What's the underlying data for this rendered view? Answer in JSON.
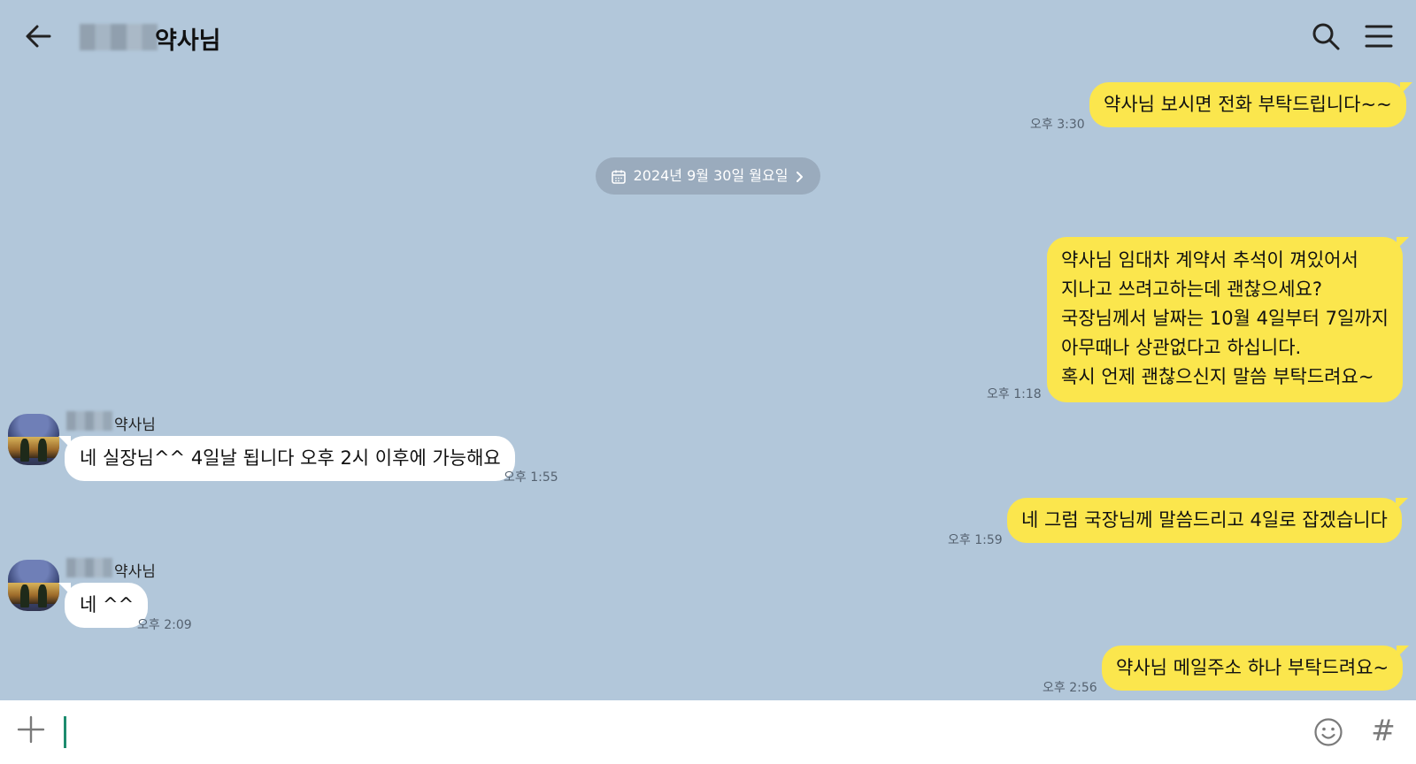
{
  "header": {
    "contact_name": "약사님",
    "icons": {
      "back": "arrow-left-icon",
      "search": "search-icon",
      "menu": "hamburger-menu-icon"
    }
  },
  "date_separator": {
    "label": "2024년 9월 30일 월요일",
    "icon": "calendar-icon",
    "chevron": "chevron-right-icon"
  },
  "messages": [
    {
      "direction": "out",
      "text": "약사님 보시면 전화 부탁드립니다~~",
      "time": "오후 3:30"
    },
    {
      "direction": "out",
      "lines": [
        "약사님 임대차 계약서 추석이 껴있어서",
        "지나고 쓰려고하는데 괜찮으세요?",
        "국장님께서 날짜는 10월 4일부터 7일까지",
        "아무때나 상관없다고 하십니다.",
        "혹시 언제 괜찮으신지 말씀 부탁드려요~"
      ],
      "time": "오후 1:18"
    },
    {
      "direction": "in",
      "sender": "약사님",
      "text": "네 실장님^^ 4일날 됩니다 오후 2시 이후에 가능해요",
      "time": "오후 1:55"
    },
    {
      "direction": "out",
      "text": "네 그럼 국장님께 말씀드리고 4일로 잡겠습니다",
      "time": "오후 1:59"
    },
    {
      "direction": "in",
      "sender": "약사님",
      "text": "네 ^^",
      "time": "오후 2:09"
    },
    {
      "direction": "out",
      "text": "약사님 메일주소 하나 부탁드려요~",
      "time": "오후 2:56"
    }
  ],
  "input_bar": {
    "value": "",
    "hash_label": "#",
    "icons": {
      "plus": "plus-icon",
      "emoji": "emoji-icon",
      "hash": "hashtag-icon"
    }
  },
  "colors": {
    "background": "#b2c7da",
    "outgoing_bubble": "#fbe64d",
    "incoming_bubble": "#ffffff",
    "date_pill": "#9aabbd",
    "caret": "#1d8c6e"
  }
}
